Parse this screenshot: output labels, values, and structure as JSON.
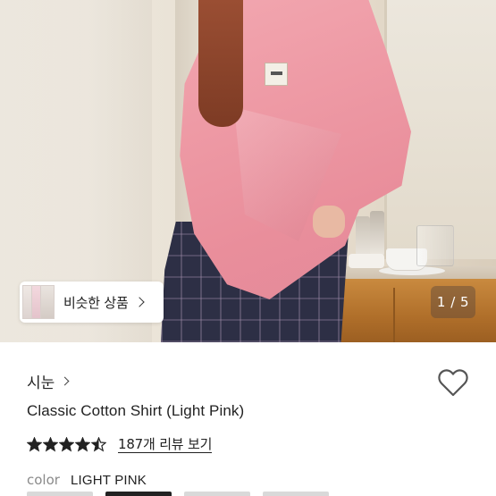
{
  "gallery": {
    "current_index": 1,
    "total": 5,
    "counter_text": "1 / 5"
  },
  "similar_products": {
    "label": "비슷한 상품"
  },
  "product": {
    "brand": "시눈",
    "title": "Classic Cotton Shirt (Light Pink)",
    "rating": 4.5,
    "rating_max": 5,
    "reviews_text": "187개 리뷰 보기",
    "option_key": "color",
    "option_value": "LIGHT PINK",
    "wishlisted": false
  },
  "colors": {
    "star": "#222222",
    "shirt": "#EE9AA5",
    "heart_outline": "#555555"
  },
  "icons": [
    "chevron-right-icon",
    "heart-icon",
    "star-icon"
  ]
}
